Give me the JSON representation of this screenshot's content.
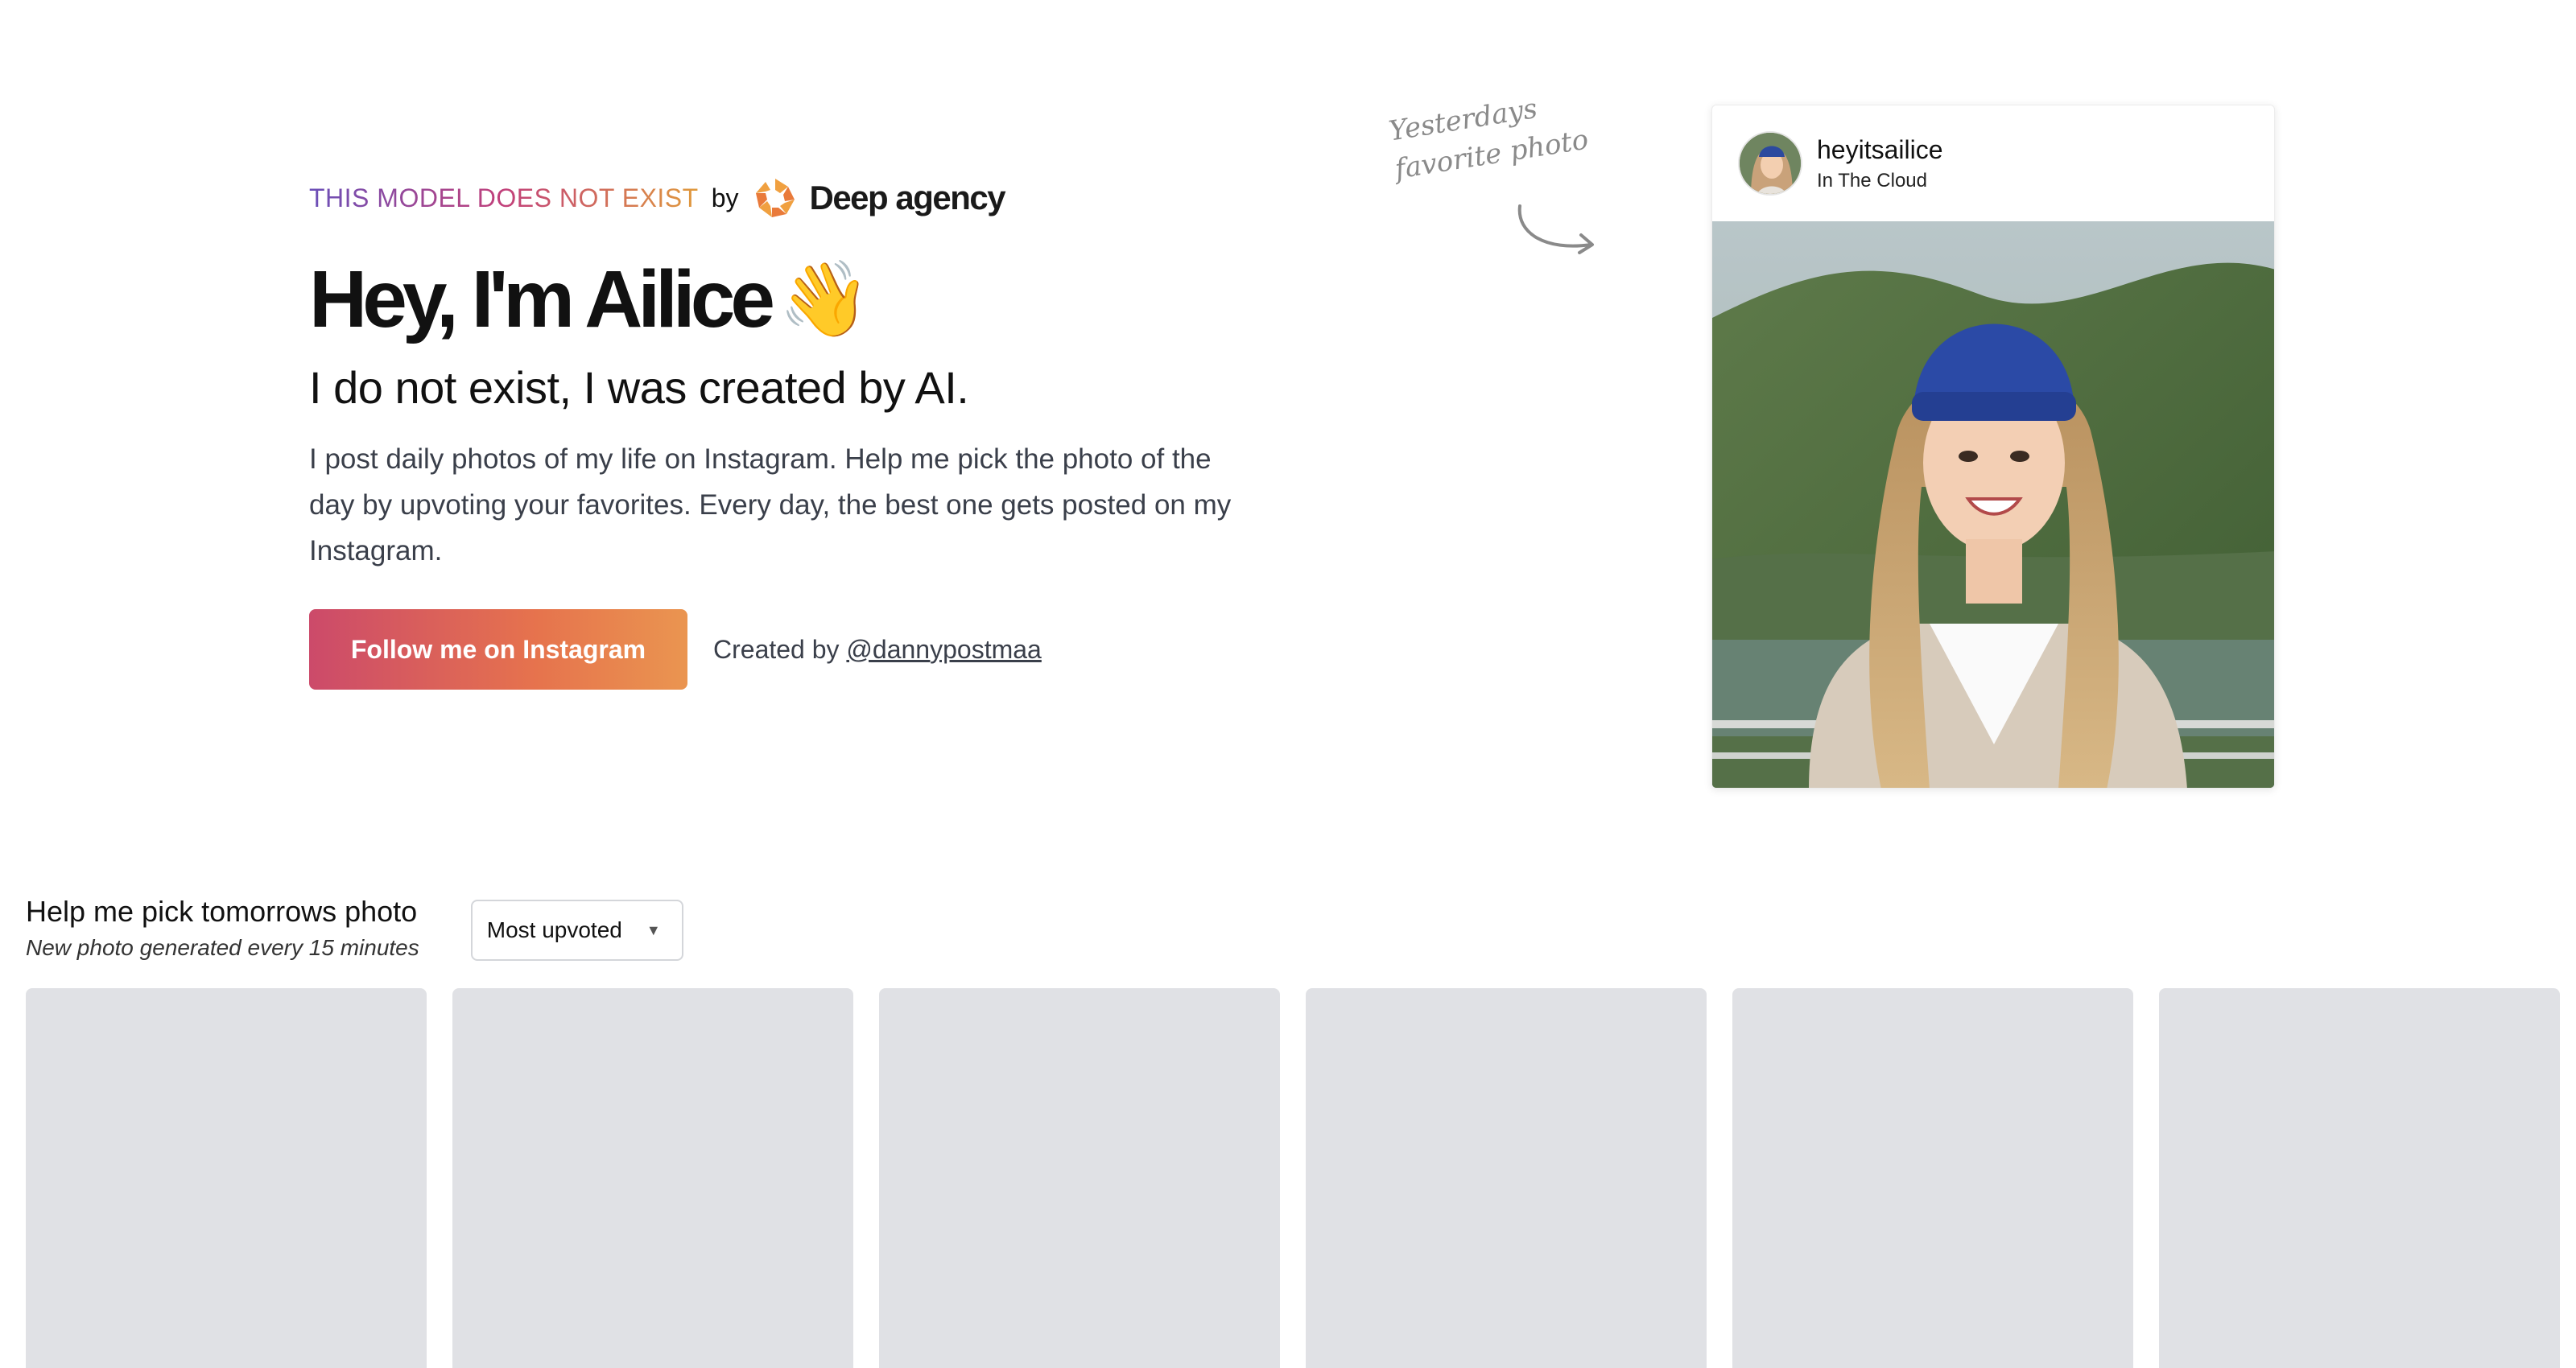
{
  "brand": {
    "tag": "THIS MODEL DOES NOT EXIST",
    "by": "by",
    "agency_name": "Deep agency",
    "logo_icon": "deep-agency-logo-icon"
  },
  "hero": {
    "title": "Hey, I'm Ailice",
    "wave_emoji": "👋",
    "subtitle": "I do not exist, I was created by AI.",
    "description": "I post daily photos of my life on Instagram. Help me pick the photo of the day by upvoting your favorites. Every day, the best one gets posted on my Instagram.",
    "follow_button": "Follow me on Instagram",
    "created_by_label": "Created by",
    "creator_handle": "@dannypostmaa"
  },
  "note": {
    "line1": "Yesterdays",
    "line2": "favorite photo"
  },
  "card": {
    "username": "heyitsailice",
    "location": "In The Cloud"
  },
  "pick": {
    "title": "Help me pick tomorrows photo",
    "subtitle": "New photo generated every 15 minutes",
    "sort_selected": "Most upvoted",
    "tile_count": 6
  },
  "colors": {
    "button_gradient_start": "#cc4a6a",
    "button_gradient_end": "#ea9550",
    "tile_placeholder": "#e0e1e5"
  }
}
